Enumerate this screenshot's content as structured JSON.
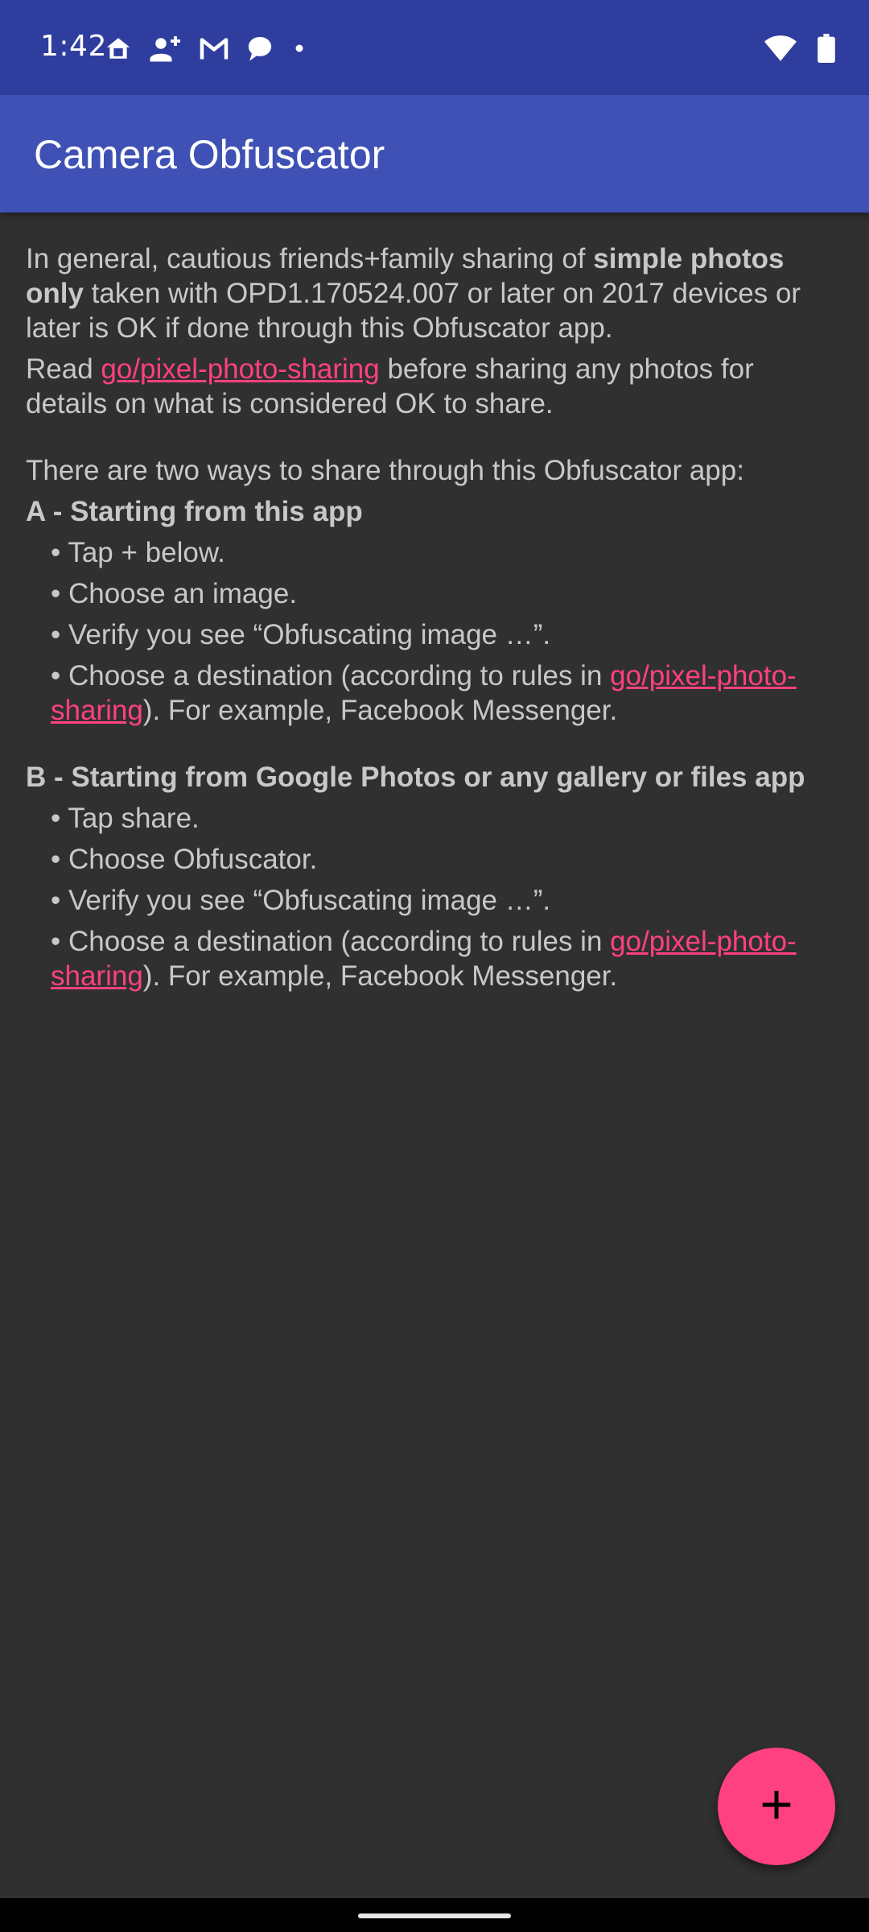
{
  "status_bar": {
    "time": "1:42",
    "left_icons": [
      "home-icon",
      "person-add-icon",
      "gmail-icon",
      "chat-bubble-icon",
      "dot-icon"
    ],
    "right_icons": [
      "wifi-icon",
      "battery-icon"
    ]
  },
  "app_bar": {
    "title": "Camera Obfuscator"
  },
  "content": {
    "intro": {
      "prefix": "In general, cautious friends+family sharing of ",
      "bold": "simple photos only",
      "suffix": " taken with OPD1.170524.007 or later on 2017 devices or later is OK if done through this Obfuscator app."
    },
    "read": {
      "prefix": "Read ",
      "link": "go/pixel-photo-sharing",
      "suffix": " before sharing any photos for details on what is considered OK to share."
    },
    "ways_intro": "There are two ways to share through this Obfuscator app:",
    "section_a": {
      "title": "A - Starting from this app",
      "bullets": [
        "• Tap + below.",
        "• Choose an image.",
        "• Verify you see “Obfuscating image …”."
      ],
      "last_bullet": {
        "prefix": "• Choose a destination (according to rules in ",
        "link": "go/pixel-photo-sharing",
        "suffix": "). For example, Facebook Messenger."
      }
    },
    "section_b": {
      "title": "B - Starting from Google Photos or any gallery or files app",
      "bullets": [
        "• Tap share.",
        "• Choose Obfuscator.",
        "• Verify you see “Obfuscating image …”."
      ],
      "last_bullet": {
        "prefix": "• Choose a destination (according to rules in ",
        "link": "go/pixel-photo-sharing",
        "suffix": "). For example, Facebook Messenger."
      }
    }
  },
  "fab": {
    "icon": "plus-icon"
  },
  "colors": {
    "status_bar": "#2f3e9e",
    "app_bar": "#3f51b5",
    "background": "#303030",
    "text": "#c8c8c8",
    "accent": "#ff4081"
  }
}
